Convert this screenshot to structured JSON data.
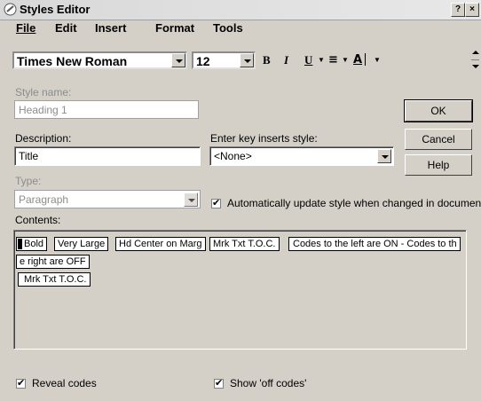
{
  "window": {
    "title": "Styles Editor",
    "help_btn": "?",
    "close_btn": "×"
  },
  "menu": {
    "items": [
      "File",
      "Edit",
      "Insert",
      "Format",
      "Tools"
    ]
  },
  "toolbar": {
    "font_name": "Times New Roman",
    "font_size": "12",
    "bold": "B",
    "italic": "I",
    "underline": "U",
    "align": "≡",
    "font_style": "A̲│"
  },
  "form": {
    "style_name_label": "Style name:",
    "style_name_value": "Heading 1",
    "description_label": "Description:",
    "description_value": "Title",
    "enter_key_label": "Enter key inserts style:",
    "enter_key_value": "<None>",
    "type_label": "Type:",
    "type_value": "Paragraph",
    "auto_update_label": "Automatically update style when changed in document",
    "contents_label": "Contents:",
    "reveal_codes_label": "Reveal codes",
    "show_off_codes_label": "Show 'off codes'"
  },
  "buttons": {
    "ok": "OK",
    "cancel": "Cancel",
    "help": "Help"
  },
  "contents": {
    "codes_row1": [
      "Bold",
      "Very Large",
      "Hd Center on Marg",
      "Mrk Txt T.O.C."
    ],
    "text_row1": "Codes to the left are ON - Codes to th",
    "text_row2": "e right are OFF",
    "code_row3": "Mrk Txt T.O.C."
  }
}
